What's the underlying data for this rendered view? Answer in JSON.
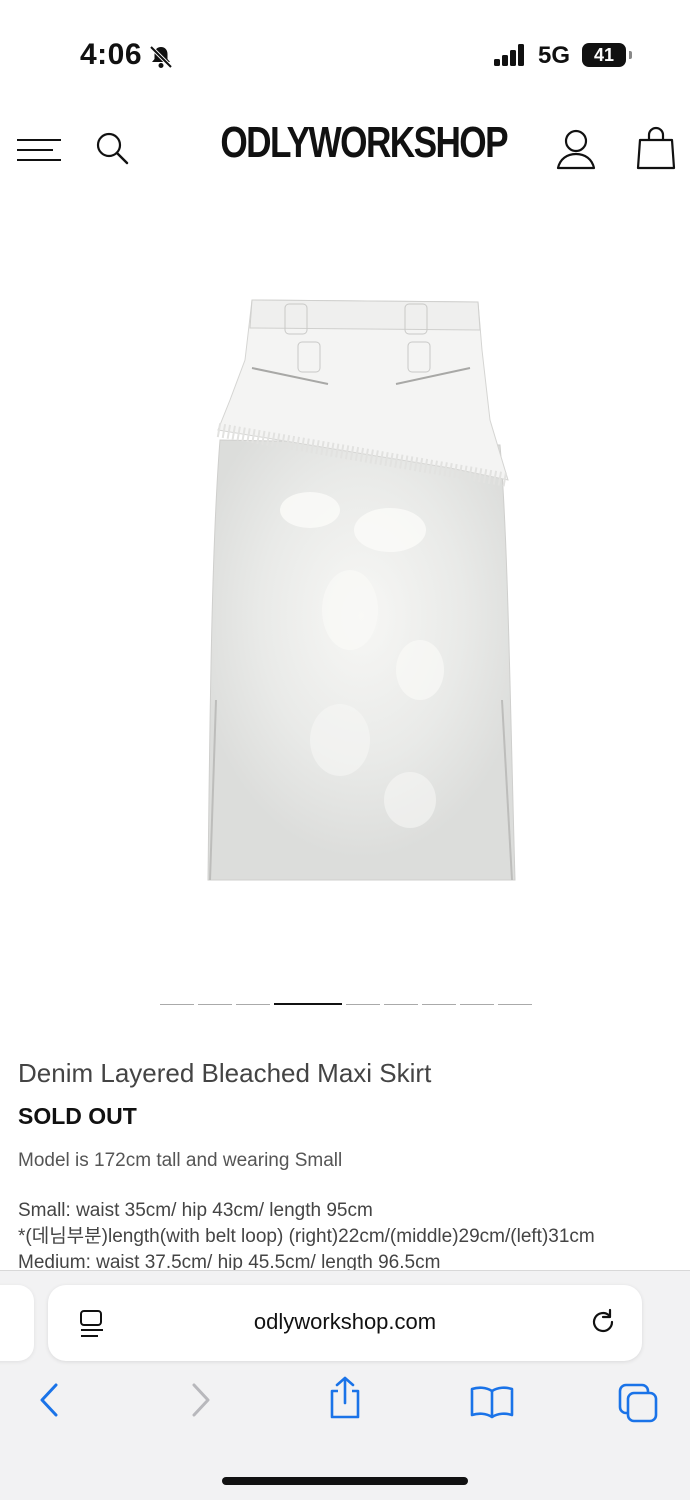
{
  "status_bar": {
    "time": "4:06",
    "network": "5G",
    "battery": "41"
  },
  "header": {
    "logo": "ODLYWORKSHOP",
    "menu_icon": "hamburger-icon",
    "search_icon": "search-icon",
    "account_icon": "user-icon",
    "bag_icon": "shopping-bag-icon"
  },
  "gallery": {
    "image_alt": "skirt-photo",
    "slide_count": 9,
    "active_slide": 4
  },
  "product": {
    "title": "Denim Layered Bleached Maxi Skirt",
    "status": "SOLD OUT",
    "model_note": "Model is 172cm tall and wearing Small",
    "size_lines": [
      "Small: waist 35cm/ hip 43cm/ length 95cm",
      "*(데님부분)length(with belt loop) (right)22cm/(middle)29cm/(left)31cm",
      "Medium: waist 37.5cm/ hip 45.5cm/ length 96.5cm"
    ]
  },
  "browser": {
    "url": "odlyworkshop.com",
    "reader_icon": "reader-icon",
    "reload_icon": "reload-icon",
    "toolbar": [
      "back-icon",
      "forward-icon",
      "share-icon",
      "bookmarks-icon",
      "tabs-icon"
    ]
  }
}
